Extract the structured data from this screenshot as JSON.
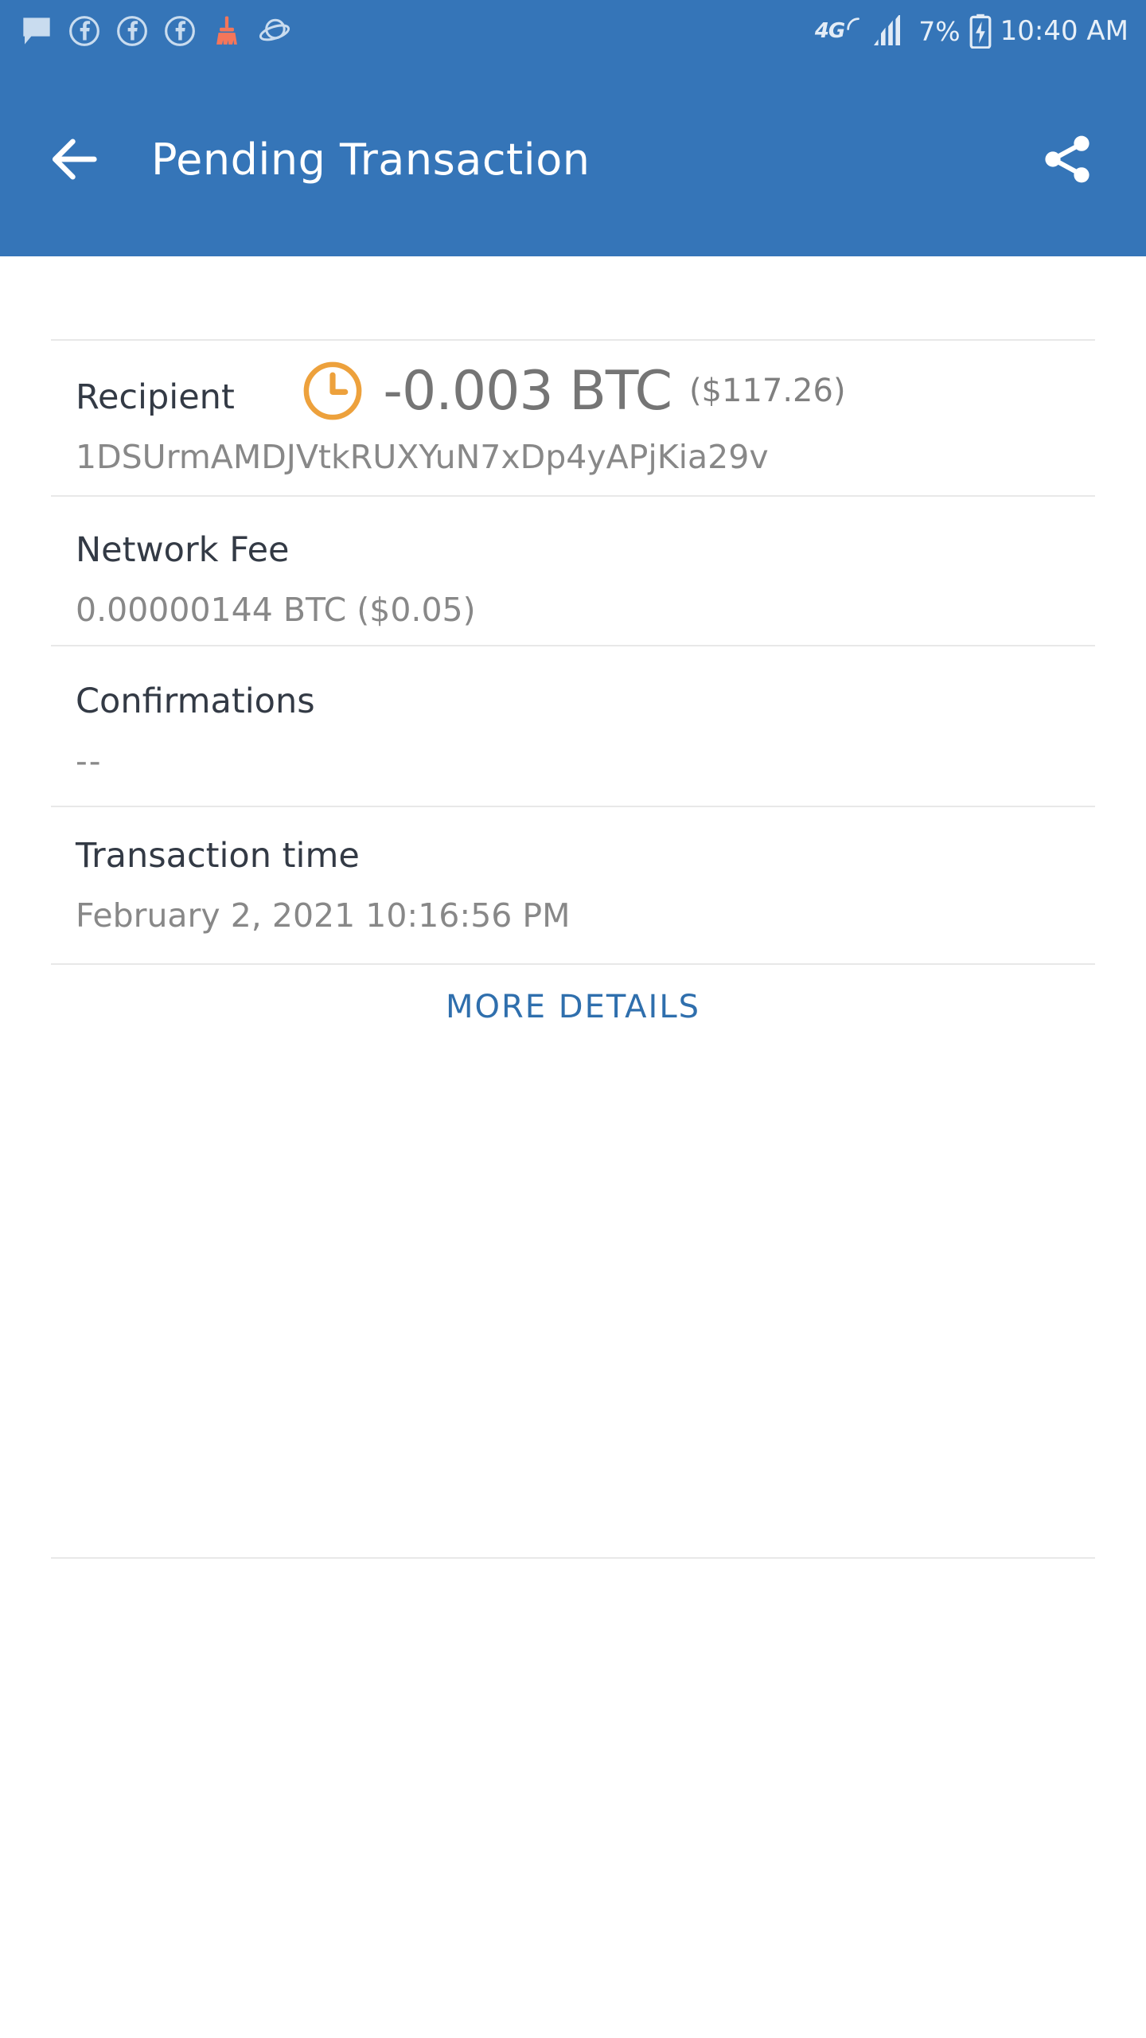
{
  "status_bar": {
    "left_icons": [
      {
        "name": "message-bubble-icon",
        "label": "message"
      },
      {
        "name": "facebook-icon-1",
        "label": "facebook"
      },
      {
        "name": "facebook-icon-2",
        "label": "facebook"
      },
      {
        "name": "facebook-icon-3",
        "label": "facebook"
      },
      {
        "name": "broom-cleaner-icon",
        "label": "cleaner"
      },
      {
        "name": "samsung-internet-icon",
        "label": "browser"
      }
    ],
    "network_type": "4G",
    "signal_label": "signal-bars",
    "battery_percent": "7%",
    "battery_state": "charging",
    "clock": "10:40 AM"
  },
  "app_bar": {
    "back_label": "back",
    "title": "Pending Transaction",
    "share_label": "share"
  },
  "transaction": {
    "status_icon": "pending-clock-icon",
    "amount": "-0.003 BTC",
    "fiat_amount": "($117.26)",
    "fields": [
      {
        "label": "Recipient",
        "value": "1DSUrmAMDJVtkRUXYuN7xDp4yAPjKia29v"
      },
      {
        "label": "Network Fee",
        "value": "0.00000144 BTC ($0.05)"
      },
      {
        "label": "Confirmations",
        "value": "--"
      },
      {
        "label": "Transaction time",
        "value": "February 2, 2021 10:16:56 PM"
      }
    ],
    "more_details_label": "MORE DETAILS"
  },
  "colors": {
    "primary": "#3575b8",
    "pending_orange": "#eda13c",
    "link_blue": "#2f6fad",
    "label_dark": "#333a45",
    "value_gray": "#888888",
    "amount_gray": "#757575",
    "divider": "#e8e8e8",
    "cleaner_orange": "#f4765a"
  }
}
